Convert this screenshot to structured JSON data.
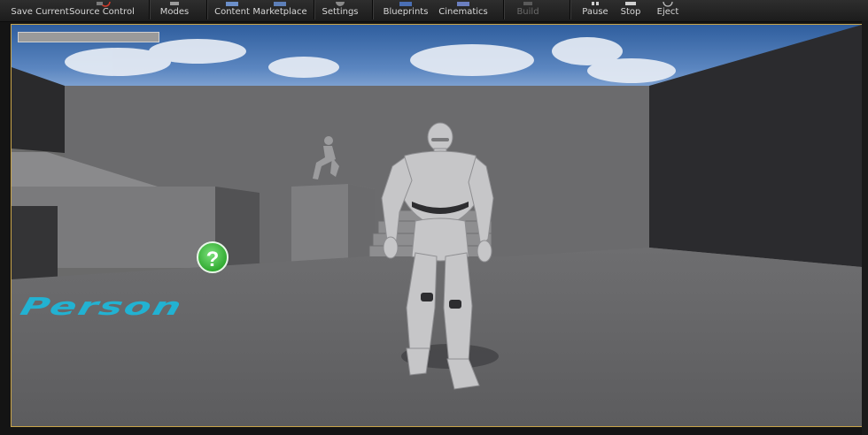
{
  "toolbar": {
    "buttons": [
      {
        "label": "Save Current",
        "icon": "save-icon"
      },
      {
        "label": "Source Control",
        "icon": "source-control-icon"
      },
      {
        "label": "Modes",
        "icon": "modes-icon"
      },
      {
        "label": "Content",
        "icon": "content-icon"
      },
      {
        "label": "Marketplace",
        "icon": "marketplace-icon"
      },
      {
        "label": "Settings",
        "icon": "settings-icon"
      },
      {
        "label": "Blueprints",
        "icon": "blueprints-icon"
      },
      {
        "label": "Cinematics",
        "icon": "cinematics-icon"
      },
      {
        "label": "Build",
        "icon": "build-icon",
        "disabled": true
      },
      {
        "label": "Pause",
        "icon": "pause-icon"
      },
      {
        "label": "Stop",
        "icon": "stop-icon"
      },
      {
        "label": "Eject",
        "icon": "eject-icon"
      }
    ]
  },
  "viewport": {
    "floor_text": "rd Person",
    "loading_progress": 0
  },
  "colors": {
    "viewport_border": "#c9a54a",
    "floor_text": "#1fb6d8",
    "pickup_green": "#3cc63c"
  }
}
